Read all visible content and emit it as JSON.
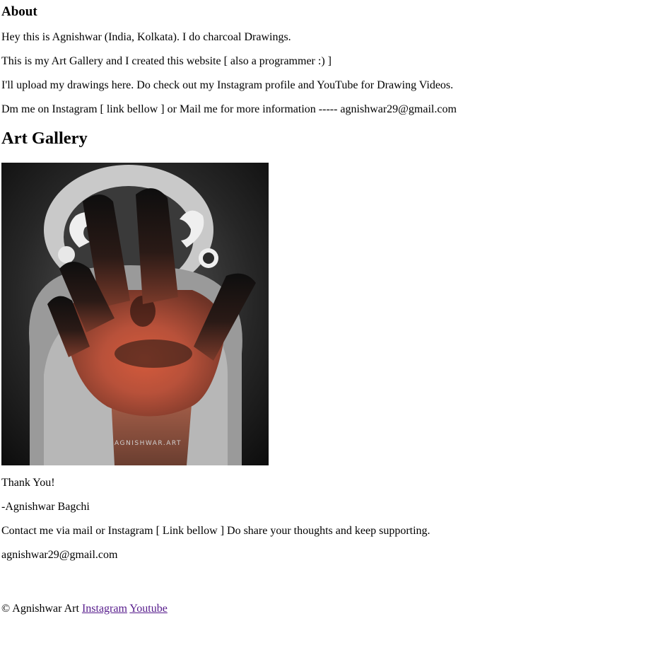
{
  "about": {
    "heading": "About",
    "lines": [
      "Hey this is Agnishwar (India, Kolkata). I do charcoal Drawings.",
      "This is my Art Gallery and I created this website [ also a programmer :) ]",
      "I'll upload my drawings here. Do check out my Instagram profile and YouTube for Drawing Videos.",
      "Dm me on Instagram [ link bellow ] or Mail me for more information ----- agnishwar29@gmail.com"
    ]
  },
  "gallery": {
    "heading": "Art Gallery",
    "artwork_watermark": "AGNISHWAR.ART"
  },
  "closing": {
    "thanks": "Thank You!",
    "signature": "-Agnishwar Bagchi",
    "contact": "Contact me via mail or Instagram [ Link bellow ] Do share your thoughts and keep supporting.",
    "email": "agnishwar29@gmail.com"
  },
  "footer": {
    "copyright": "© Agnishwar Art",
    "instagram_label": "Instagram",
    "youtube_label": "Youtube",
    "link_color": "#551a8b"
  }
}
